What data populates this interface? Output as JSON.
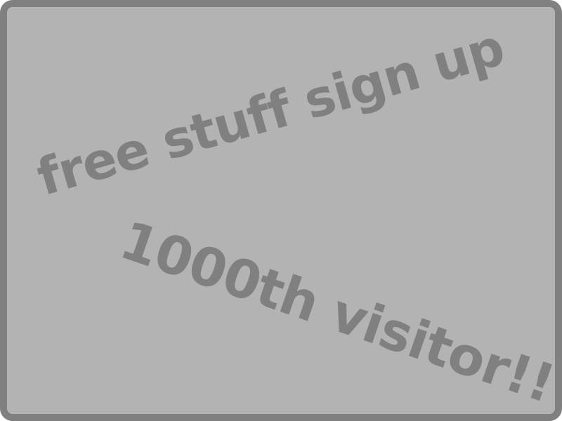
{
  "banner": {
    "line_1": "free stuff sign up",
    "line_2": "1000th visitor!!"
  },
  "colors": {
    "background": "#b3b3b3",
    "border": "#808080",
    "text": "#808080"
  }
}
